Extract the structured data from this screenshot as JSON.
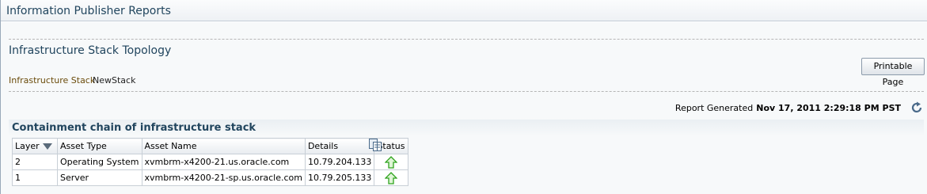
{
  "header": {
    "title": "Information Publisher Reports"
  },
  "report": {
    "title": "Infrastructure Stack Topology",
    "printable_button": "Printable Page",
    "breadcrumb": {
      "label": "Infrastructure Stack",
      "value": "NewStack"
    },
    "generated_label": "Report Generated",
    "generated_value": "Nov 17, 2011 2:29:18 PM PST"
  },
  "region": {
    "title": "Containment chain of infrastructure stack"
  },
  "table": {
    "columns": [
      "Layer",
      "Asset Type",
      "Asset Name",
      "Details",
      "Status"
    ],
    "sort_column": "Layer",
    "sort_direction": "descending",
    "rows": [
      {
        "layer": "2",
        "asset_type": "Operating System",
        "asset_name": "xvmbrm-x4200-21.us.oracle.com",
        "details": "10.79.204.133",
        "status": "up"
      },
      {
        "layer": "1",
        "asset_type": "Server",
        "asset_name": "xvmbrm-x4200-21-sp.us.oracle.com",
        "details": "10.79.205.133",
        "status": "up"
      }
    ]
  },
  "icons": {
    "refresh": "refresh-icon",
    "sort": "sort-descending-icon",
    "status_up": "status-up-arrow-icon",
    "export": "export-table-icon"
  },
  "colors": {
    "title": "#21455e",
    "crumb_label": "#6b4c0b",
    "status_up": "#2ea31d",
    "refresh": "#4a6a8a"
  }
}
